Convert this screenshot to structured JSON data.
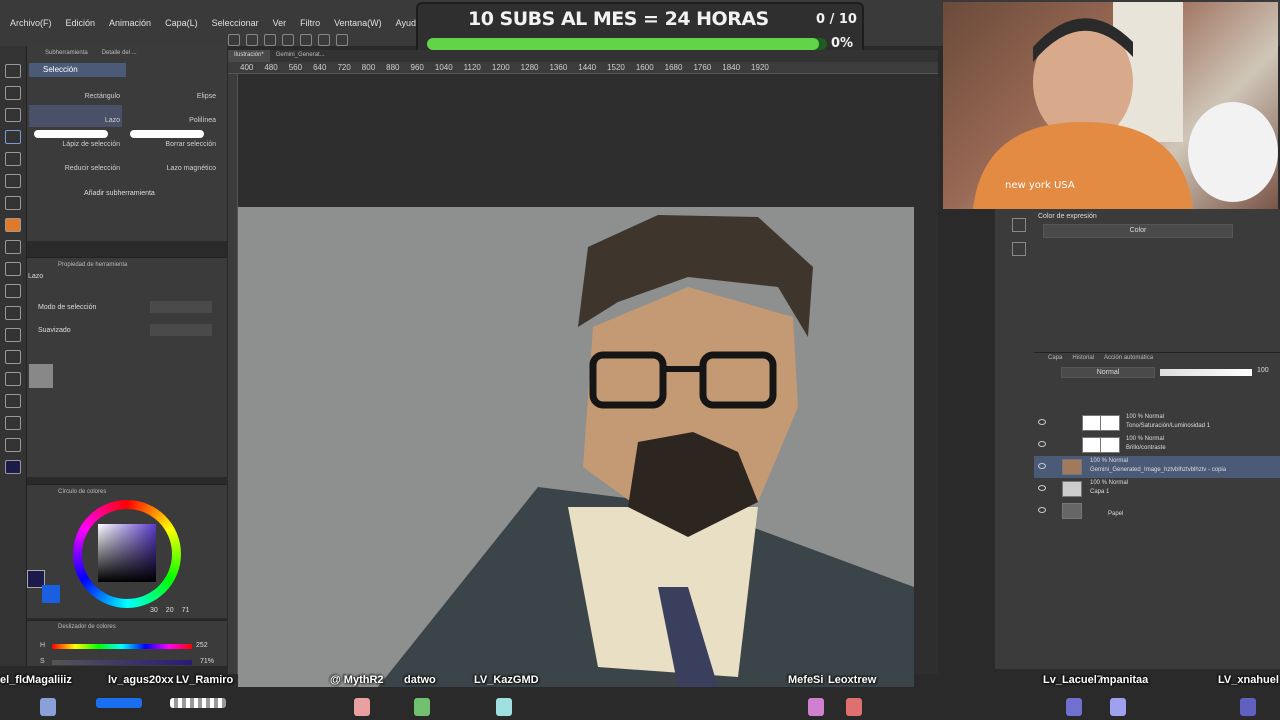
{
  "menu": [
    "Archivo(F)",
    "Edición",
    "Animación",
    "Capa(L)",
    "Seleccionar",
    "Ver",
    "Filtro",
    "Ventana(W)",
    "Ayuda(H)"
  ],
  "overlay": {
    "title": "10 SUBS AL MES = 24 HORAS",
    "count": "0 / 10",
    "percent_text": "0%",
    "progress": 0.98,
    "bar_color": "#62d449"
  },
  "subtool": {
    "tabs": [
      "Subherramienta",
      "Detalle del ..."
    ],
    "group_label": "Selección",
    "items": [
      "Rectángulo",
      "Elipse",
      "Lazo",
      "Polilínea",
      "Lápiz de selección",
      "Borrar selección",
      "Reducir selección",
      "Lazo magnético"
    ],
    "add_label": "Añadir subherramienta"
  },
  "tool_property": {
    "title": "Propiedad de herramienta",
    "tool_name": "Lazo",
    "rows": [
      {
        "label": "Modo de selección"
      },
      {
        "label": "Suavizado"
      }
    ]
  },
  "color_wheel": {
    "title": "Círculo de colores",
    "values": [
      "30",
      "20",
      "71"
    ],
    "main_color": "#1c1a4a",
    "sub_color": "#1a5fe0"
  },
  "color_slider": {
    "title": "Deslizador de colores",
    "h_label": "H",
    "h_value": "252",
    "s_label": "S",
    "s_value": "71%"
  },
  "doc_tabs": [
    "Ilustración*",
    "Gemini_Generat..."
  ],
  "ruler_labels": [
    "400",
    "480",
    "560",
    "640",
    "720",
    "800",
    "880",
    "960",
    "1040",
    "1120",
    "1200",
    "1280",
    "1360",
    "1440",
    "1520",
    "1600",
    "1680",
    "1760",
    "1840",
    "1920"
  ],
  "expression": {
    "title": "Color de expresión",
    "value": "Color"
  },
  "layers_panel": {
    "tabs": [
      "Capa",
      "Historial",
      "Acción automática"
    ],
    "blend_mode": "Normal",
    "opacity": "100",
    "layers": [
      {
        "line1": "100 % Normal",
        "line2": "Tono/Saturación/Luminosidad 1",
        "selected": false
      },
      {
        "line1": "100 % Normal",
        "line2": "Brillo/contraste",
        "selected": false
      },
      {
        "line1": "100 % Normal",
        "line2": "Gemini_Generated_Image_hztvblhztvblhztv - copia",
        "selected": true
      },
      {
        "line1": "100 % Normal",
        "line2": "Capa 1",
        "selected": false
      },
      {
        "line1": "",
        "line2": "Papel",
        "selected": false
      }
    ]
  },
  "webcam": {
    "shirt_text": "new york USA"
  },
  "chat_names": [
    "el_flo",
    "Magaliiiz",
    "lv_agus20xx",
    "LV_Ramiro",
    "@ MythR2",
    "datwo",
    "LV_KazGMD",
    "MefeSi",
    "Leoxtrew",
    "Lv_Lacuel7",
    "mpanitaa",
    "LV_xnahuel"
  ]
}
